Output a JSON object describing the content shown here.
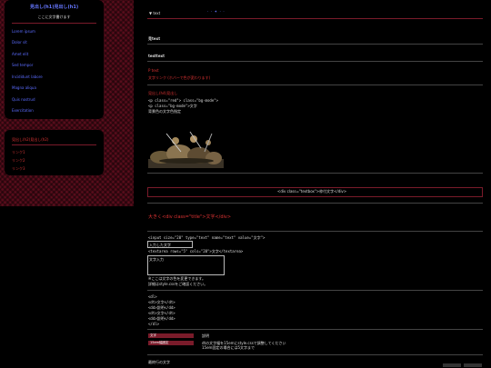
{
  "site": {
    "title": "見出し(h1)見出し(h1)",
    "subtitle": "ここに文字書けます"
  },
  "nav": {
    "items": [
      "Lorem ipsum",
      "Dolor sit",
      "Amet elit",
      "Sed tempor",
      "Incididunt labore",
      "Magna aliqua",
      "Quis nostrud",
      "Exercitation"
    ]
  },
  "sidebar2": {
    "title": "見出し(h2)見出し(h2)",
    "items": [
      "リンク1",
      "リンク2",
      "リンク3"
    ]
  },
  "main": {
    "breadcrumb": "▼ text",
    "heading1": "見text",
    "heading2": "testtext",
    "red_line1": "P text",
    "red_line2": "文字リンク (ホバーで色が変わります)",
    "code_title": "見出し(h4)見出し",
    "code_line1": "<p class=\"red\"> class=\"bg-mode\">",
    "code_line2": "<p class=\"bg-mode\">文字",
    "code_line3": "背景色の文字色指定",
    "divbox": "<div class=\"textbox\">枠付文字</div>",
    "title_text": "大きく<div class=\"title\">文字</div>",
    "form_line1": "<input size=\"20\" type=\"text\" name=\"text\" value=\"文字\">",
    "input_value": "入力した文字",
    "form_line2": "<textarea rows=\"5\" cols=\"20\">文字</textarea>",
    "textarea_value": "文字入力",
    "note1": "※ここは文字の色を変更できます。",
    "note2": "詳細はstyle.cssをご確認ください。",
    "dl_lines": [
      "<dl>",
      "<dt>文字</dt>",
      "<dd>説明</dd>",
      "<dt>文字</dt>",
      "<dd>説明</dd>",
      "</dl>"
    ],
    "table_rows": [
      {
        "label": "文字",
        "value": "説明"
      },
      {
        "label": "15em幅固定",
        "value": "dtの文字幅を15emにstyle.cssで調整してください\n15em固定の場合には5文字まで"
      }
    ],
    "footer_note": "最終行の文字"
  }
}
